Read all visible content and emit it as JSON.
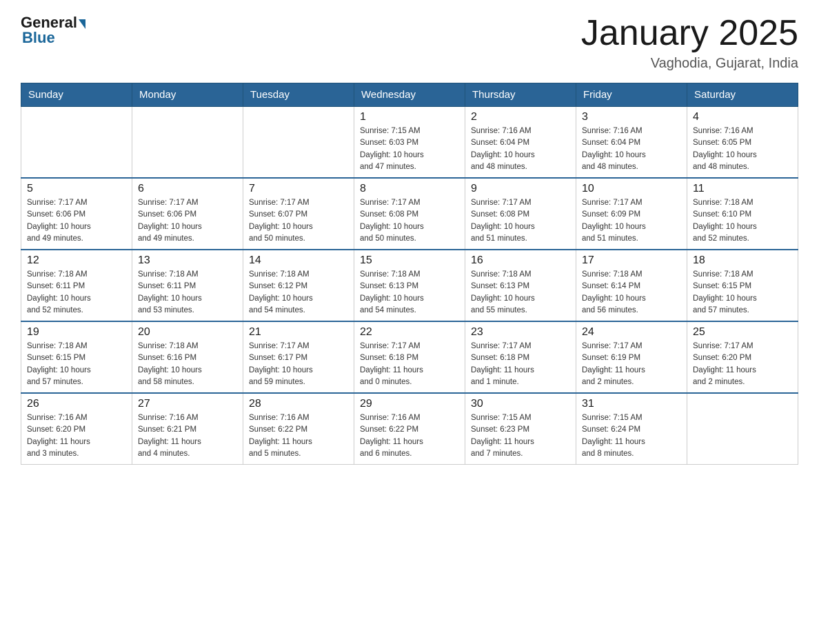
{
  "header": {
    "logo_general": "General",
    "logo_blue": "Blue",
    "title": "January 2025",
    "location": "Vaghodia, Gujarat, India"
  },
  "weekdays": [
    "Sunday",
    "Monday",
    "Tuesday",
    "Wednesday",
    "Thursday",
    "Friday",
    "Saturday"
  ],
  "weeks": [
    [
      {
        "day": "",
        "info": ""
      },
      {
        "day": "",
        "info": ""
      },
      {
        "day": "",
        "info": ""
      },
      {
        "day": "1",
        "info": "Sunrise: 7:15 AM\nSunset: 6:03 PM\nDaylight: 10 hours\nand 47 minutes."
      },
      {
        "day": "2",
        "info": "Sunrise: 7:16 AM\nSunset: 6:04 PM\nDaylight: 10 hours\nand 48 minutes."
      },
      {
        "day": "3",
        "info": "Sunrise: 7:16 AM\nSunset: 6:04 PM\nDaylight: 10 hours\nand 48 minutes."
      },
      {
        "day": "4",
        "info": "Sunrise: 7:16 AM\nSunset: 6:05 PM\nDaylight: 10 hours\nand 48 minutes."
      }
    ],
    [
      {
        "day": "5",
        "info": "Sunrise: 7:17 AM\nSunset: 6:06 PM\nDaylight: 10 hours\nand 49 minutes."
      },
      {
        "day": "6",
        "info": "Sunrise: 7:17 AM\nSunset: 6:06 PM\nDaylight: 10 hours\nand 49 minutes."
      },
      {
        "day": "7",
        "info": "Sunrise: 7:17 AM\nSunset: 6:07 PM\nDaylight: 10 hours\nand 50 minutes."
      },
      {
        "day": "8",
        "info": "Sunrise: 7:17 AM\nSunset: 6:08 PM\nDaylight: 10 hours\nand 50 minutes."
      },
      {
        "day": "9",
        "info": "Sunrise: 7:17 AM\nSunset: 6:08 PM\nDaylight: 10 hours\nand 51 minutes."
      },
      {
        "day": "10",
        "info": "Sunrise: 7:17 AM\nSunset: 6:09 PM\nDaylight: 10 hours\nand 51 minutes."
      },
      {
        "day": "11",
        "info": "Sunrise: 7:18 AM\nSunset: 6:10 PM\nDaylight: 10 hours\nand 52 minutes."
      }
    ],
    [
      {
        "day": "12",
        "info": "Sunrise: 7:18 AM\nSunset: 6:11 PM\nDaylight: 10 hours\nand 52 minutes."
      },
      {
        "day": "13",
        "info": "Sunrise: 7:18 AM\nSunset: 6:11 PM\nDaylight: 10 hours\nand 53 minutes."
      },
      {
        "day": "14",
        "info": "Sunrise: 7:18 AM\nSunset: 6:12 PM\nDaylight: 10 hours\nand 54 minutes."
      },
      {
        "day": "15",
        "info": "Sunrise: 7:18 AM\nSunset: 6:13 PM\nDaylight: 10 hours\nand 54 minutes."
      },
      {
        "day": "16",
        "info": "Sunrise: 7:18 AM\nSunset: 6:13 PM\nDaylight: 10 hours\nand 55 minutes."
      },
      {
        "day": "17",
        "info": "Sunrise: 7:18 AM\nSunset: 6:14 PM\nDaylight: 10 hours\nand 56 minutes."
      },
      {
        "day": "18",
        "info": "Sunrise: 7:18 AM\nSunset: 6:15 PM\nDaylight: 10 hours\nand 57 minutes."
      }
    ],
    [
      {
        "day": "19",
        "info": "Sunrise: 7:18 AM\nSunset: 6:15 PM\nDaylight: 10 hours\nand 57 minutes."
      },
      {
        "day": "20",
        "info": "Sunrise: 7:18 AM\nSunset: 6:16 PM\nDaylight: 10 hours\nand 58 minutes."
      },
      {
        "day": "21",
        "info": "Sunrise: 7:17 AM\nSunset: 6:17 PM\nDaylight: 10 hours\nand 59 minutes."
      },
      {
        "day": "22",
        "info": "Sunrise: 7:17 AM\nSunset: 6:18 PM\nDaylight: 11 hours\nand 0 minutes."
      },
      {
        "day": "23",
        "info": "Sunrise: 7:17 AM\nSunset: 6:18 PM\nDaylight: 11 hours\nand 1 minute."
      },
      {
        "day": "24",
        "info": "Sunrise: 7:17 AM\nSunset: 6:19 PM\nDaylight: 11 hours\nand 2 minutes."
      },
      {
        "day": "25",
        "info": "Sunrise: 7:17 AM\nSunset: 6:20 PM\nDaylight: 11 hours\nand 2 minutes."
      }
    ],
    [
      {
        "day": "26",
        "info": "Sunrise: 7:16 AM\nSunset: 6:20 PM\nDaylight: 11 hours\nand 3 minutes."
      },
      {
        "day": "27",
        "info": "Sunrise: 7:16 AM\nSunset: 6:21 PM\nDaylight: 11 hours\nand 4 minutes."
      },
      {
        "day": "28",
        "info": "Sunrise: 7:16 AM\nSunset: 6:22 PM\nDaylight: 11 hours\nand 5 minutes."
      },
      {
        "day": "29",
        "info": "Sunrise: 7:16 AM\nSunset: 6:22 PM\nDaylight: 11 hours\nand 6 minutes."
      },
      {
        "day": "30",
        "info": "Sunrise: 7:15 AM\nSunset: 6:23 PM\nDaylight: 11 hours\nand 7 minutes."
      },
      {
        "day": "31",
        "info": "Sunrise: 7:15 AM\nSunset: 6:24 PM\nDaylight: 11 hours\nand 8 minutes."
      },
      {
        "day": "",
        "info": ""
      }
    ]
  ]
}
